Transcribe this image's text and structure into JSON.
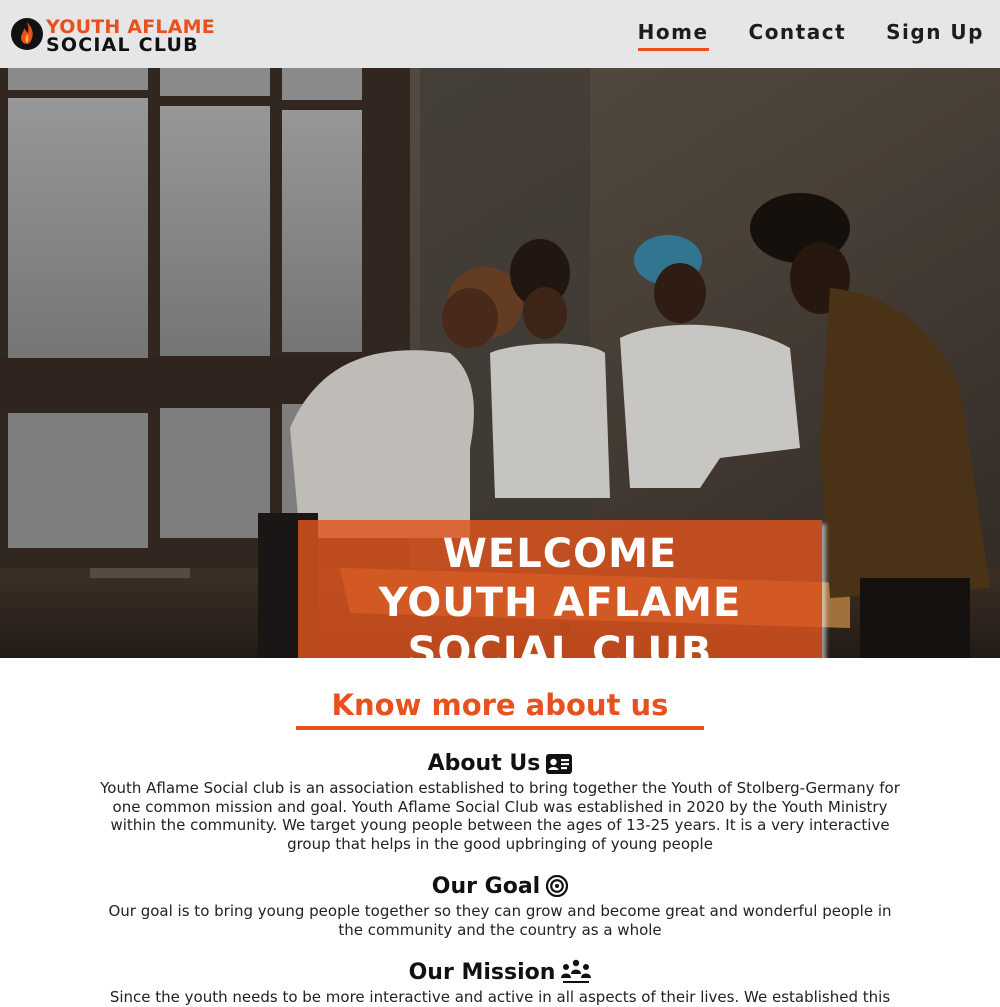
{
  "header": {
    "logo_line1": "YOUTH AFLAME",
    "logo_line2": "SOCIAL CLUB",
    "nav": [
      {
        "label": "Home",
        "active": true
      },
      {
        "label": "Contact",
        "active": false
      },
      {
        "label": "Sign Up",
        "active": false
      }
    ]
  },
  "hero": {
    "lines": [
      "WELCOME",
      "YOUTH AFLAME",
      "SOCIAL CLUB"
    ],
    "image": "photo of four young people gathered around a wooden table by a large window"
  },
  "main": {
    "title": "Know more about us",
    "sections": [
      {
        "heading": "About Us",
        "icon": "id-card-icon",
        "text": "Youth Aflame Social club is an association established to bring together the Youth of Stolberg-Germany for one common mission and goal. Youth Aflame Social Club was established in 2020 by the Youth Ministry within the community. We target young people between the ages of 13-25 years. It is a very interactive group that helps in the good upbringing of young people"
      },
      {
        "heading": "Our Goal",
        "icon": "target-icon",
        "text": "Our goal is to bring young people together so they can grow and become great and wonderful people in the community and the country as a whole"
      },
      {
        "heading": "Our Mission",
        "icon": "people-group-icon",
        "text": "Since the youth needs to be more interactive and active in all aspects of their lives. We established this"
      }
    ]
  },
  "colors": {
    "accent": "#e8501e",
    "header_bg": "#e6e6e6",
    "hero_overlay": "#de541e"
  }
}
